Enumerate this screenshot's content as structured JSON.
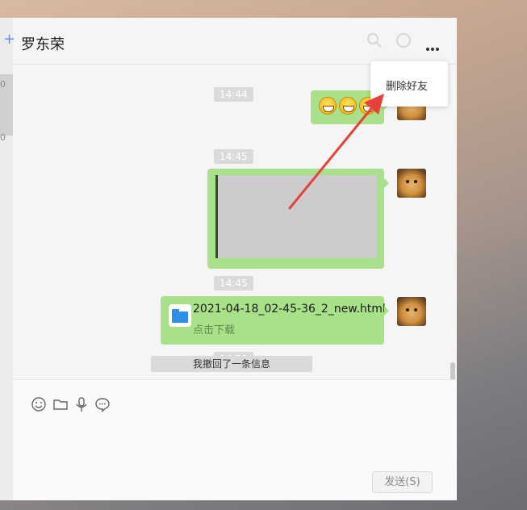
{
  "sidebar": {
    "digits": [
      "0",
      "0"
    ]
  },
  "header": {
    "title": "罗东荣",
    "more_icon": "more-dots-icon"
  },
  "popup": {
    "delete_friend": "删除好友"
  },
  "messages": {
    "time1": "14:44",
    "time2": "14:45",
    "time3": "14:45",
    "file_name": "2021-04-18_02-45-36_2_new.html",
    "file_action": "点击下载",
    "time4": "14:50",
    "recall_notice": "我撤回了一条信息"
  },
  "toolbar": {
    "icons": [
      "emoji-icon",
      "folder-icon",
      "microphone-icon",
      "chat-bubble-icon"
    ]
  },
  "send_button": "发送(S)",
  "colors": {
    "bubble": "#a9e08a",
    "arrow": "#e8403a"
  }
}
